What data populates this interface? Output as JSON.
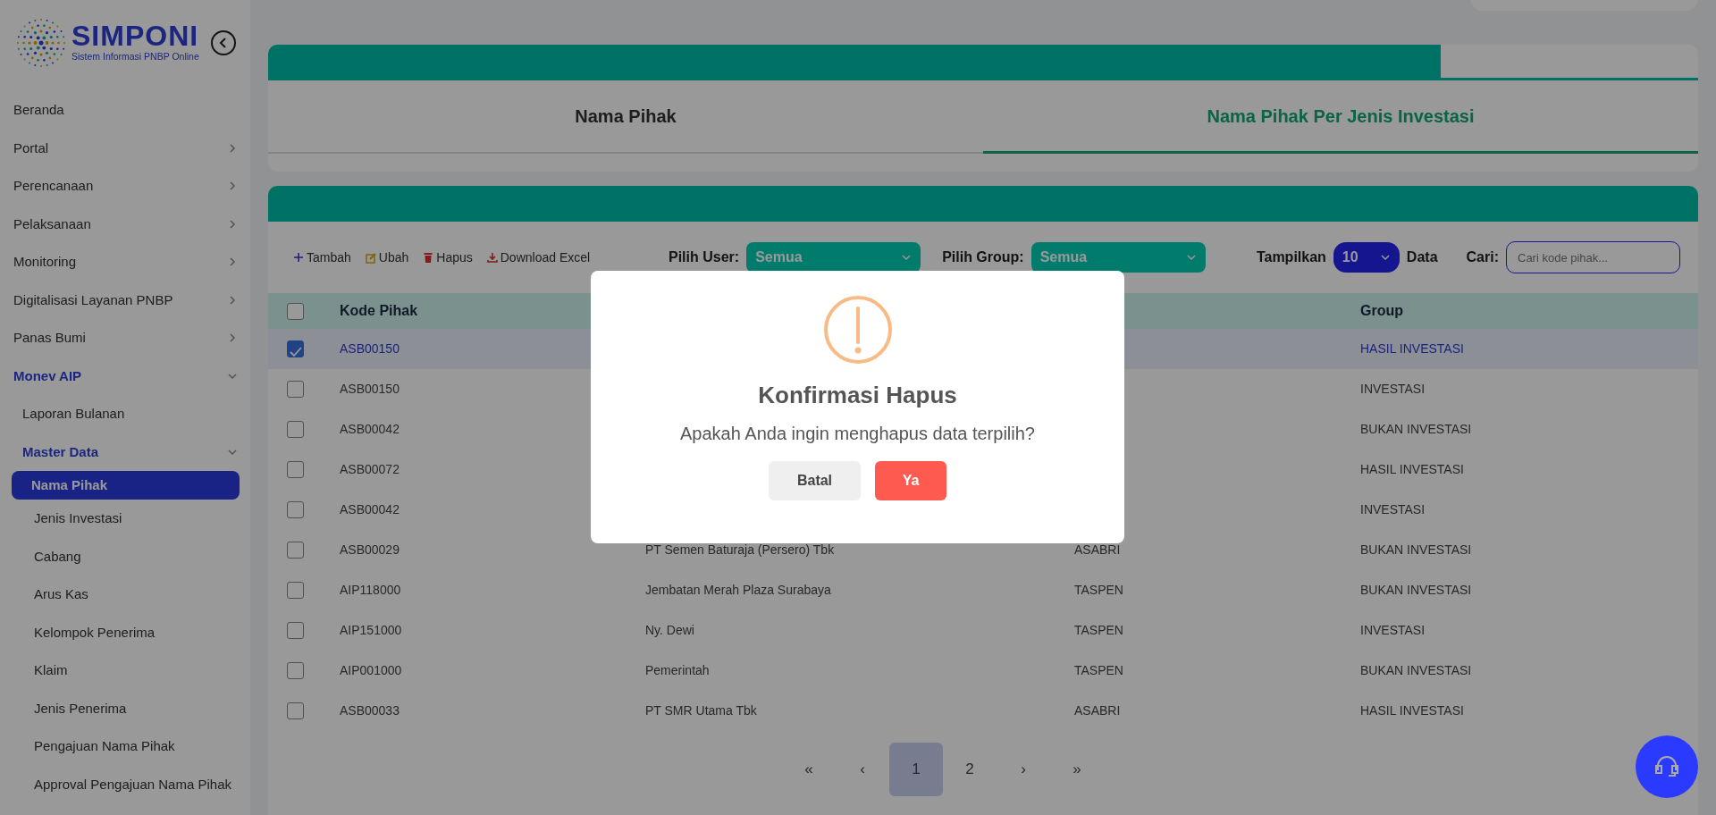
{
  "sidebar": {
    "logo": {
      "title": "SIMPONI",
      "subtitle": "Sistem Informasi PNBP Online"
    },
    "items": [
      {
        "label": "Beranda",
        "kind": "link",
        "selected": false
      },
      {
        "label": "Portal",
        "kind": "group",
        "expanded": false
      },
      {
        "label": "Perencanaan",
        "kind": "group",
        "expanded": false
      },
      {
        "label": "Pelaksanaan",
        "kind": "group",
        "expanded": false
      },
      {
        "label": "Monitoring",
        "kind": "group",
        "expanded": false
      },
      {
        "label": "Digitalisasi Layanan PNBP",
        "kind": "group",
        "expanded": false
      },
      {
        "label": "Panas Bumi",
        "kind": "group",
        "expanded": false
      },
      {
        "label": "Monev AIP",
        "kind": "group",
        "expanded": true,
        "children": [
          {
            "label": "Laporan Bulanan",
            "kind": "link",
            "selected": false
          },
          {
            "label": "Master Data",
            "kind": "group",
            "expanded": true,
            "children": [
              {
                "label": "Nama Pihak",
                "kind": "link",
                "selected": true
              },
              {
                "label": "Jenis Investasi",
                "kind": "link",
                "selected": false
              },
              {
                "label": "Cabang",
                "kind": "link",
                "selected": false
              },
              {
                "label": "Arus Kas",
                "kind": "link",
                "selected": false
              },
              {
                "label": "Kelompok Penerima",
                "kind": "link",
                "selected": false
              },
              {
                "label": "Klaim",
                "kind": "link",
                "selected": false
              },
              {
                "label": "Jenis Penerima",
                "kind": "link",
                "selected": false
              },
              {
                "label": "Pengajuan Nama Pihak",
                "kind": "link",
                "selected": false
              },
              {
                "label": "Approval Pengajuan Nama Pihak",
                "kind": "link",
                "selected": false
              }
            ]
          }
        ]
      }
    ]
  },
  "tabs": [
    {
      "label": "Nama Pihak",
      "selected": false
    },
    {
      "label": "Nama Pihak Per Jenis Investasi",
      "selected": true
    }
  ],
  "toolbar": {
    "actions": [
      {
        "label": "Tambah",
        "kind": "add"
      },
      {
        "label": "Ubah",
        "kind": "edit"
      },
      {
        "label": "Hapus",
        "kind": "delete"
      },
      {
        "label": "Download Excel",
        "kind": "download"
      }
    ],
    "filters": [
      {
        "label": "Pilih User:",
        "value": "Semua"
      },
      {
        "label": "Pilih Group:",
        "value": "Semua"
      }
    ],
    "page_size": {
      "label": "Tampilkan",
      "value": "10",
      "suffix": "Data"
    },
    "search": {
      "label": "Cari:",
      "placeholder": "Cari kode pihak..."
    }
  },
  "table": {
    "select_all": {
      "checked": false
    },
    "columns": {
      "column_1": "Kode Pihak",
      "column_4": "Group"
    },
    "rows": [
      {
        "selected": true,
        "column_1": "ASB00150",
        "column_4": "HASIL INVESTASI"
      },
      {
        "selected": false,
        "column_1": "ASB00150",
        "column_4": "INVESTASI"
      },
      {
        "selected": false,
        "column_1": "ASB00042",
        "column_4": "BUKAN INVESTASI"
      },
      {
        "selected": false,
        "column_1": "ASB00072",
        "column_4": "HASIL INVESTASI"
      },
      {
        "selected": false,
        "column_1": "ASB00042",
        "column_4": "INVESTASI"
      },
      {
        "selected": false,
        "column_1": "ASB00029",
        "column_2": "PT Semen Baturaja (Persero) Tbk",
        "column_3": "ASABRI",
        "column_4": "BUKAN INVESTASI"
      },
      {
        "selected": false,
        "column_1": "AIP118000",
        "column_2": "Jembatan Merah Plaza Surabaya",
        "column_3": "TASPEN",
        "column_4": "BUKAN INVESTASI"
      },
      {
        "selected": false,
        "column_1": "AIP151000",
        "column_2": "Ny. Dewi",
        "column_3": "TASPEN",
        "column_4": "INVESTASI"
      },
      {
        "selected": false,
        "column_1": "AIP001000",
        "column_2": "Pemerintah",
        "column_3": "TASPEN",
        "column_4": "BUKAN INVESTASI"
      },
      {
        "selected": false,
        "column_1": "ASB00033",
        "column_2": "PT SMR Utama Tbk",
        "column_3": "ASABRI",
        "column_4": "HASIL INVESTASI"
      }
    ]
  },
  "pagination": [
    {
      "label": "«",
      "selected": false
    },
    {
      "label": "‹",
      "selected": false
    },
    {
      "label": "1",
      "selected": true
    },
    {
      "label": "2",
      "selected": false
    },
    {
      "label": "›",
      "selected": false
    },
    {
      "label": "»",
      "selected": false
    }
  ],
  "modal": {
    "title": "Konfirmasi Hapus",
    "message": "Apakah Anda ingin menghapus data terpilih?",
    "buttons": [
      {
        "label": "Batal",
        "kind": "secondary"
      },
      {
        "label": "Ya",
        "kind": "danger"
      }
    ]
  }
}
